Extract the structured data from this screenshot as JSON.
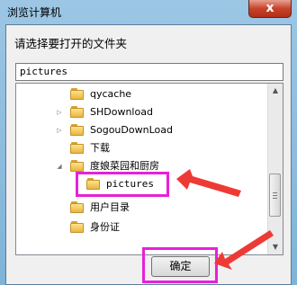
{
  "window": {
    "title": "浏览计算机",
    "close_glyph": "x"
  },
  "prompt": "请选择要打开的文件夹",
  "path_field": {
    "value": "pictures"
  },
  "tree": {
    "items": [
      {
        "label": "qycache",
        "expander": ""
      },
      {
        "label": "SHDownload",
        "expander": "▷"
      },
      {
        "label": "SogouDownLoad",
        "expander": "▷"
      },
      {
        "label": "下载",
        "expander": ""
      },
      {
        "label": "度娘菜园和厨房",
        "expander": "◢"
      },
      {
        "label": "pictures",
        "expander": ""
      },
      {
        "label": "用户目录",
        "expander": ""
      },
      {
        "label": "身份证",
        "expander": ""
      }
    ]
  },
  "buttons": {
    "ok": "确定"
  },
  "colors": {
    "highlight": "#e820d8",
    "arrow": "#ee3a35"
  }
}
